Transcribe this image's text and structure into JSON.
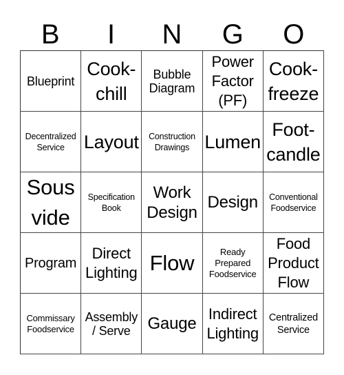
{
  "header": {
    "letters": [
      "B",
      "I",
      "N",
      "G",
      "O"
    ]
  },
  "board": {
    "rows": [
      [
        "Blueprint",
        "Cook-\nchill",
        "Bubble\nDiagram",
        "Power\nFactor\n(PF)",
        "Cook-\nfreeze"
      ],
      [
        "Decentralized\nService",
        "Layout",
        "Construction\nDrawings",
        "Lumen",
        "Foot-\ncandle"
      ],
      [
        "Sous\nvide",
        "Specification\nBook",
        "Work\nDesign",
        "Design",
        "Conventional\nFoodservice"
      ],
      [
        "Program",
        "Direct\nLighting",
        "Flow",
        "Ready\nPrepared\nFoodservice",
        "Food\nProduct\nFlow"
      ],
      [
        "Commissary\nFoodservice",
        "Assembly\n/ Serve",
        "Gauge",
        "Indirect\nLighting",
        "Centralized\nService"
      ]
    ]
  }
}
